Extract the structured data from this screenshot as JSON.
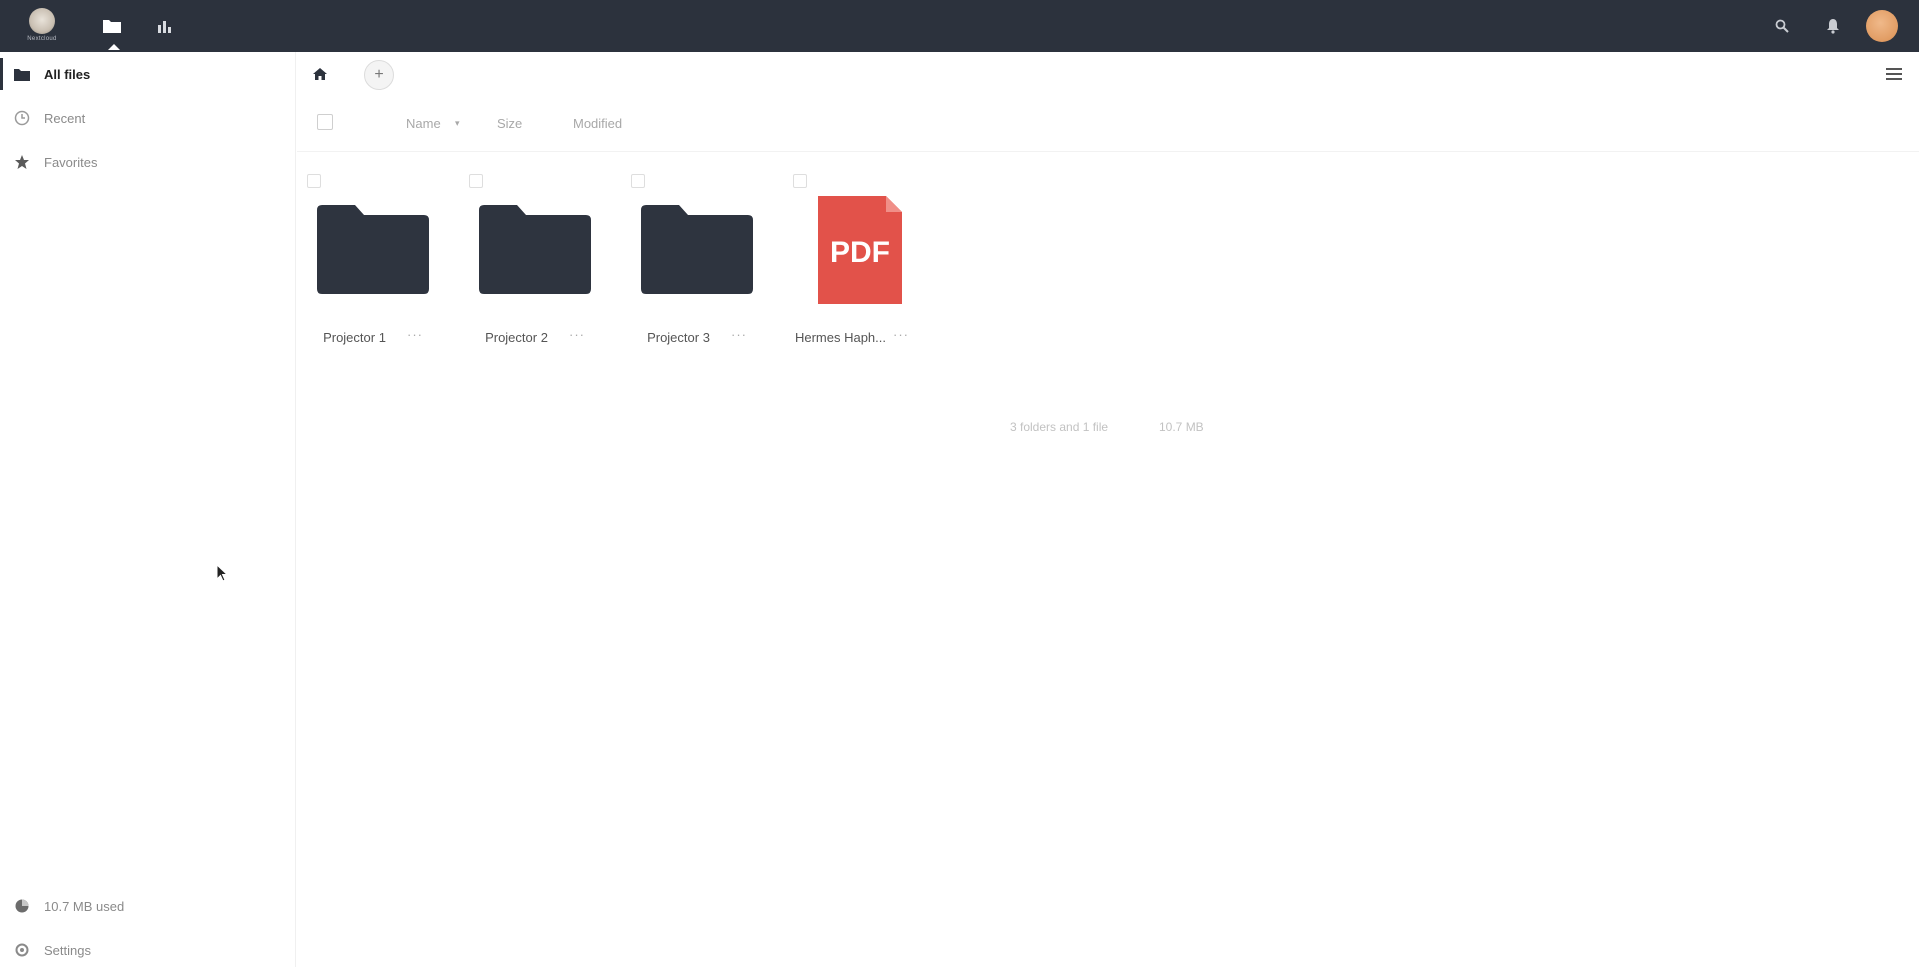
{
  "header": {
    "logo_text": "Nextcloud",
    "apps": [
      {
        "name": "Files",
        "icon": "folder-icon"
      },
      {
        "name": "Activity",
        "icon": "activity-icon"
      }
    ],
    "right_icons": [
      "search-icon",
      "bell-icon",
      "avatar"
    ],
    "colors": {
      "background": "#2c323d",
      "avatar": "#e19c63"
    }
  },
  "sidebar": {
    "items": [
      {
        "label": "All files",
        "icon": "folder-icon",
        "active": true
      },
      {
        "label": "Recent",
        "icon": "clock-icon",
        "active": false
      },
      {
        "label": "Favorites",
        "icon": "star-icon",
        "active": false
      }
    ],
    "footer": {
      "quota_label": "10.7 MB used",
      "settings_label": "Settings"
    }
  },
  "controls": {
    "home_icon": "home-icon",
    "add_label": "+",
    "view_toggle_icon": "list-view-icon"
  },
  "list_header": {
    "name": "Name",
    "size": "Size",
    "modified": "Modified"
  },
  "files": [
    {
      "name": "Projector 1",
      "type": "folder"
    },
    {
      "name": "Projector 2",
      "type": "folder"
    },
    {
      "name": "Projector 3",
      "type": "folder"
    },
    {
      "name": "Hermes Haph...",
      "type": "pdf",
      "badge": "PDF"
    }
  ],
  "summary": {
    "counts": "3 folders and 1 file",
    "size": "10.7 MB"
  },
  "colors": {
    "folder": "#2e343f",
    "pdf": "#e2524a"
  }
}
